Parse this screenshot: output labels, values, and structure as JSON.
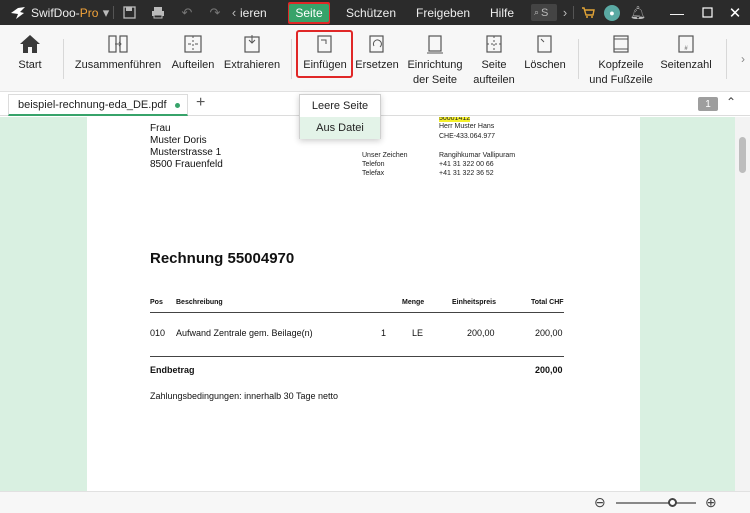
{
  "titlebar": {
    "app_name": "SwifDoo-",
    "app_name_pro": "Pro",
    "menu": [
      "ieren",
      "Seite",
      "Schützen",
      "Freigeben",
      "Hilfe"
    ],
    "active_menu": "Seite",
    "search_text": "S",
    "avatar_letter": "●"
  },
  "ribbon": {
    "buttons": [
      {
        "label": "Start"
      },
      {
        "label": "Zusammenführen"
      },
      {
        "label": "Aufteilen"
      },
      {
        "label": "Extrahieren"
      },
      {
        "label": "Einfügen"
      },
      {
        "label": "Ersetzen"
      },
      {
        "label": "Einrichtung\nder Seite"
      },
      {
        "label": "Seite\naufteilen"
      },
      {
        "label": "Löschen"
      },
      {
        "label": "Kopfzeile\nund Fußzeile"
      },
      {
        "label": "Seitenzahl"
      }
    ]
  },
  "tabs": {
    "doc_name": "beispiel-rechnung-eda_DE.pdf",
    "page_number": "1"
  },
  "dropdown": {
    "items": [
      "Leere Seite",
      "Aus Datei"
    ],
    "hovered": "Aus Datei"
  },
  "document": {
    "address": [
      "Frau",
      "Muster Doris",
      "Musterstrasse 1",
      "8500 Frauenfeld"
    ],
    "meta_rows": [
      {
        "value": "50001412",
        "highlight": true
      },
      {
        "value": "Herr Muster Hans"
      },
      {
        "value": "CHE-433.064.977"
      },
      {
        "label": "Unser Zeichen",
        "value": "Rangihkumar Vallipuram"
      },
      {
        "label": "Telefon",
        "value": "+41 31 322 00 66"
      },
      {
        "label": "Telefax",
        "value": "+41 31 322 36 52"
      }
    ],
    "title": "Rechnung 55004970",
    "table": {
      "headers": [
        "Pos",
        "Beschreibung",
        "Menge",
        "Einheitspreis",
        "Total CHF"
      ],
      "rows": [
        [
          "010",
          "Aufwand Zentrale gem. Beilage(n)",
          "1",
          "LE",
          "200,00",
          "200,00"
        ]
      ]
    },
    "total_label": "Endbetrag",
    "total_value": "200,00",
    "terms": "Zahlungsbedingungen: innerhalb 30 Tage netto"
  },
  "zoom_level": 0.7
}
